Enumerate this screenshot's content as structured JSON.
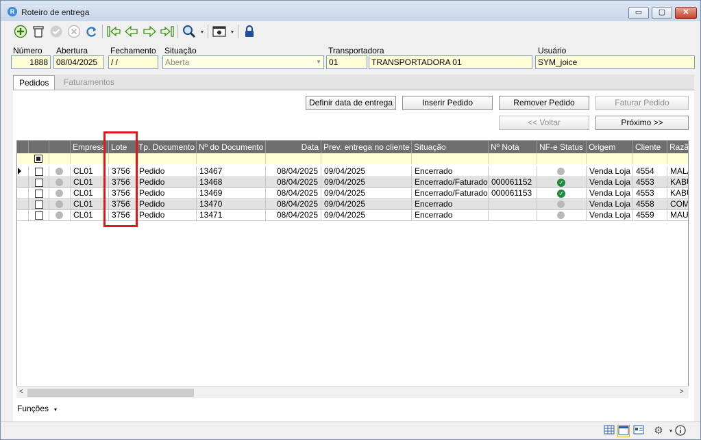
{
  "window": {
    "title": "Roteiro de entrega",
    "minimize_glyph": "▭",
    "maximize_glyph": "▢",
    "close_glyph": "✕"
  },
  "toolbar": {
    "icons": [
      "add-icon",
      "delete-icon",
      "confirm-icon",
      "cancel-icon",
      "refresh-icon",
      "first-record-icon",
      "previous-record-icon",
      "next-record-icon",
      "last-record-icon",
      "search-icon",
      "settings-icon",
      "lock-icon"
    ],
    "dropdown_glyph": "▾"
  },
  "header": {
    "numero_label": "Número",
    "numero_value": "1888",
    "abertura_label": "Abertura",
    "abertura_value": "08/04/2025",
    "fechamento_label": "Fechamento",
    "fechamento_value": " / /",
    "situacao_label": "Situação",
    "situacao_value": "Aberta",
    "transportadora_label": "Transportadora",
    "transportadora_code": "01",
    "transportadora_name": "TRANSPORTADORA 01",
    "usuario_label": "Usuário",
    "usuario_value": "SYM_joice"
  },
  "tabs": [
    {
      "label": "Pedidos",
      "active": true
    },
    {
      "label": "Faturamentos",
      "active": false
    }
  ],
  "actions": {
    "definir_data": "Definir data de entrega",
    "inserir": "Inserir Pedido",
    "remover": "Remover Pedido",
    "faturar": "Faturar Pedido",
    "voltar": "<< Voltar",
    "proximo": "Próximo >>"
  },
  "grid": {
    "columns": [
      "Empresa",
      "Lote",
      "Tp. Documento",
      "Nº do Documento",
      "Data",
      "Prev. entrega no cliente",
      "Situação",
      "Nº Nota",
      "NF-e Status",
      "Origem",
      "Cliente",
      "Razã"
    ],
    "rows": [
      {
        "empresa": "CL01",
        "lote": "3756",
        "tp_doc": "Pedido",
        "num_doc": "13467",
        "data": "08/04/2025",
        "prev": "09/04/2025",
        "situacao": "Encerrado",
        "nota": "",
        "nfe": "none",
        "origem": "Venda Loja",
        "cliente": "4554",
        "razao": "MALA"
      },
      {
        "empresa": "CL01",
        "lote": "3756",
        "tp_doc": "Pedido",
        "num_doc": "13468",
        "data": "08/04/2025",
        "prev": "09/04/2025",
        "situacao": "Encerrado/Faturado",
        "nota": "000061152",
        "nfe": "ok",
        "origem": "Venda Loja",
        "cliente": "4553",
        "razao": "KABU"
      },
      {
        "empresa": "CL01",
        "lote": "3756",
        "tp_doc": "Pedido",
        "num_doc": "13469",
        "data": "08/04/2025",
        "prev": "09/04/2025",
        "situacao": "Encerrado/Faturado",
        "nota": "000061153",
        "nfe": "ok",
        "origem": "Venda Loja",
        "cliente": "4553",
        "razao": "KABU"
      },
      {
        "empresa": "CL01",
        "lote": "3756",
        "tp_doc": "Pedido",
        "num_doc": "13470",
        "data": "08/04/2025",
        "prev": "09/04/2025",
        "situacao": "Encerrado",
        "nota": "",
        "nfe": "none",
        "origem": "Venda Loja",
        "cliente": "4558",
        "razao": "COMU"
      },
      {
        "empresa": "CL01",
        "lote": "3756",
        "tp_doc": "Pedido",
        "num_doc": "13471",
        "data": "08/04/2025",
        "prev": "09/04/2025",
        "situacao": "Encerrado",
        "nota": "",
        "nfe": "none",
        "origem": "Venda Loja",
        "cliente": "4559",
        "razao": "MAUI"
      }
    ]
  },
  "footer": {
    "funcoes": "Funções",
    "funcoes_glyph": "▾",
    "scroll_left_glyph": "<",
    "scroll_right_glyph": ">",
    "status_icons": [
      "grid-view-icon",
      "form-view-icon",
      "card-view-icon",
      "gear-icon",
      "info-icon"
    ]
  },
  "colors": {
    "field_bg": "#ffffd6",
    "header_bg": "#6e6e6e",
    "highlight": "#e0161c",
    "ok_status": "#1e8c3a"
  }
}
